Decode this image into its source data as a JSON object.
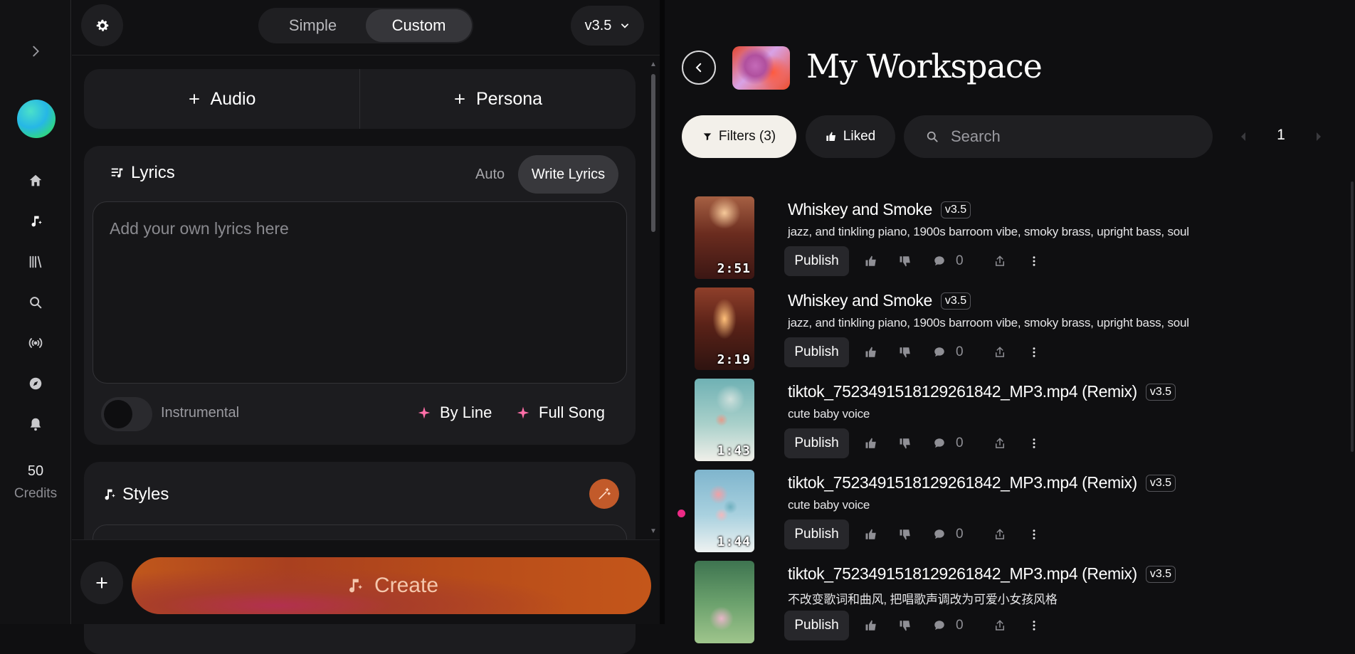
{
  "rail": {
    "credits_count": "50",
    "credits_label": "Credits"
  },
  "create": {
    "mode_simple": "Simple",
    "mode_custom": "Custom",
    "version": "v3.5",
    "audio_label": "Audio",
    "persona_label": "Persona",
    "lyrics": {
      "title": "Lyrics",
      "auto_label": "Auto",
      "write_label": "Write Lyrics",
      "placeholder": "Add your own lyrics here",
      "instrumental_label": "Instrumental",
      "by_line_label": "By Line",
      "full_song_label": "Full Song"
    },
    "styles_title": "Styles",
    "create_label": "Create"
  },
  "workspace": {
    "title": "My Workspace",
    "filters_label": "Filters (3)",
    "liked_label": "Liked",
    "search_placeholder": "Search",
    "page_number": "1",
    "songs": [
      {
        "title": "Whiskey and Smoke",
        "version": "v3.5",
        "tags": "jazz, and tinkling piano, 1900s barroom vibe, smoky brass, upright bass, soul",
        "duration": "2:51",
        "publish_label": "Publish",
        "comments": "0"
      },
      {
        "title": "Whiskey and Smoke",
        "version": "v3.5",
        "tags": "jazz, and tinkling piano, 1900s barroom vibe, smoky brass, upright bass, soul",
        "duration": "2:19",
        "publish_label": "Publish",
        "comments": "0"
      },
      {
        "title": "tiktok_7523491518129261842_MP3.mp4 (Remix)",
        "version": "v3.5",
        "tags": "cute baby voice",
        "duration": "1:43",
        "publish_label": "Publish",
        "comments": "0"
      },
      {
        "title": "tiktok_7523491518129261842_MP3.mp4 (Remix)",
        "version": "v3.5",
        "tags": "cute baby voice",
        "duration": "1:44",
        "publish_label": "Publish",
        "comments": "0"
      },
      {
        "title": "tiktok_7523491518129261842_MP3.mp4 (Remix)",
        "version": "v3.5",
        "tags": "不改变歌词和曲风, 把唱歌声调改为可爱小女孩风格",
        "duration": "",
        "publish_label": "Publish",
        "comments": "0"
      }
    ]
  },
  "colors": {
    "accent_pink": "#ec2a85",
    "sparkle_pink": "#ff6fa8",
    "create_orange": "#c0571c"
  }
}
